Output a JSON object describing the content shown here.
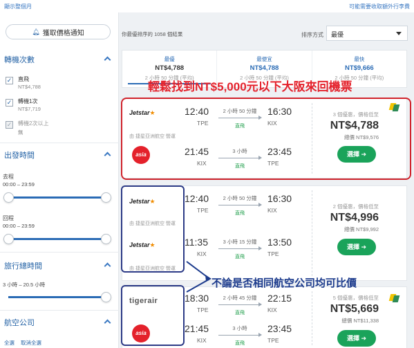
{
  "topbar": {
    "left": "顯示整個月",
    "right": "可能需要收取額外行李費"
  },
  "sidebar": {
    "alert_button": "獲取價格通知",
    "stops": {
      "title": "轉機次數",
      "options": [
        {
          "label": "直飛",
          "price": "NT$4,788",
          "checked": true
        },
        {
          "label": "轉機1次",
          "price": "NT$7,719",
          "checked": true
        },
        {
          "label": "轉機2次以上",
          "price": "無",
          "checked": true,
          "disabled": true
        }
      ]
    },
    "departure": {
      "title": "出發時間",
      "outbound_label": "去程",
      "outbound_range": "00:00 – 23:59",
      "return_label": "回程",
      "return_range": "00:00 – 23:59"
    },
    "journey": {
      "title": "旅行總時間",
      "range": "3 小時 – 20.5 小時"
    },
    "airlines": {
      "title": "航空公司",
      "select_all": "全選",
      "clear_all": "取消全選"
    }
  },
  "main": {
    "result_count": "你最優排序的 1058 個結果",
    "sort_label": "排序方式",
    "sort_value": "最優",
    "tabs": [
      {
        "title": "最優",
        "price": "NT$4,788",
        "sub": "2 小時 50 分鐘 (平均)"
      },
      {
        "title": "最便宜",
        "price": "NT$4,788",
        "sub": "2 小時 50 分鐘 (平均)"
      },
      {
        "title": "最快",
        "price": "NT$9,666",
        "sub": "2 小時 50 分鐘 (平均)"
      }
    ],
    "cards": [
      {
        "outbound": {
          "airline": "Jetstar",
          "dep": "12:40",
          "dep_code": "TPE",
          "arr": "16:30",
          "arr_code": "KIX",
          "duration": "2 小時 50 分鐘",
          "type": "直飛"
        },
        "operated": "由 捷星亞洲航空 營運",
        "return": {
          "airline": "AirAsia",
          "dep": "21:45",
          "dep_code": "KIX",
          "arr": "23:45",
          "arr_code": "TPE",
          "duration": "3 小時",
          "type": "直飛"
        },
        "deals": "3 個優惠，價格低至",
        "price": "NT$4,788",
        "total": "總價 NT$9,576",
        "select": "選擇 ➔"
      },
      {
        "outbound": {
          "airline": "Jetstar",
          "dep": "12:40",
          "dep_code": "TPE",
          "arr": "16:30",
          "arr_code": "KIX",
          "duration": "2 小時 50 分鐘",
          "type": "直飛"
        },
        "operated": "由 捷星亞洲航空 營運",
        "return": {
          "airline": "Jetstar",
          "dep": "11:35",
          "dep_code": "KIX",
          "arr": "13:50",
          "arr_code": "TPE",
          "duration": "3 小時 15 分鐘",
          "type": "直飛"
        },
        "operated2": "由 捷星亞洲航空 營運",
        "deals": "2 個優惠，價格低至",
        "price": "NT$4,996",
        "total": "總價 NT$9,992",
        "select": "選擇 ➔"
      },
      {
        "outbound": {
          "airline": "tigerair",
          "dep": "18:30",
          "dep_code": "TPE",
          "arr": "22:15",
          "arr_code": "KIX",
          "duration": "2 小時 45 分鐘",
          "type": "直飛"
        },
        "return": {
          "airline": "AirAsia",
          "dep": "21:45",
          "dep_code": "KIX",
          "arr": "23:45",
          "arr_code": "TPE",
          "duration": "3 小時",
          "type": "直飛"
        },
        "deals": "5 個優惠，價格低至",
        "price": "NT$5,669",
        "total": "總價 NT$11,338",
        "select": "選擇 ➔"
      }
    ]
  },
  "annotations": {
    "banner": "輕鬆找到NT$5,000元以下大阪來回機票",
    "note": "不論是否相同航空公司均可比價"
  },
  "colors": {
    "accent": "#2a6bb5",
    "highlight_red": "#d0222b",
    "box_blue": "#2c3a86",
    "select_green": "#1aa35a"
  }
}
